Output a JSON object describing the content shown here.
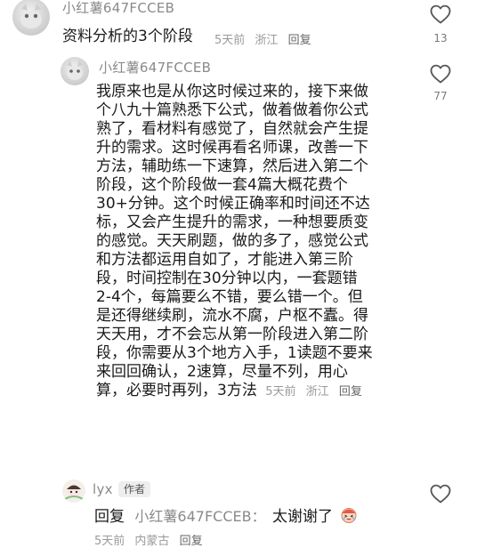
{
  "comment1": {
    "username": "小红薯647FCCEB",
    "text": "资料分析的3个阶段",
    "time": "5天前",
    "location": "浙江",
    "reply_label": "回复",
    "likes": "13"
  },
  "reply1": {
    "username": "小红薯647FCCEB",
    "lines": [
      "我原来也是从你这时候过来的，接下来做",
      "个八九十篇熟悉下公式，做着做着你公式",
      "熟了，看材料有感觉了，自然就会产生提",
      "升的需求。这时候再看名师课，改善一下",
      "方法，辅助练一下速算，然后进入第二个",
      "阶段，这个阶段做一套4篇大概花费个",
      "30+分钟。这个时候正确率和时间还不达",
      "标，又会产生提升的需求，一种想要质变",
      "的感觉。天天刷题，做的多了，感觉公式",
      "和方法都运用自如了，才能进入第三阶",
      "段，时间控制在30分钟以内，一套题错",
      "2-4个，每篇要么不错，要么错一个。但",
      "是还得继续刷，流水不腐，户枢不蠹。得",
      "天天用，才不会忘从第一阶段进入第二阶",
      "段，你需要从3个地方入手，1读题不要来",
      "来回回确认，2速算，尽量不列，用心"
    ],
    "last_line": "算，必要时再列，3方法",
    "time": "5天前",
    "location": "浙江",
    "reply_label": "回复",
    "likes": "77"
  },
  "reply2": {
    "username": "lyx",
    "author_tag": "作者",
    "prefix": "回复",
    "target": "小红薯647FCCEB：",
    "text": "太谢谢了",
    "emoji_name": "laughing-cry-emoji",
    "time": "5天前",
    "location": "内蒙古",
    "reply_label": "回复"
  },
  "icons": {
    "like": "heart-outline-icon"
  },
  "colors": {
    "text": "#1a1a1a",
    "meta": "#9a9a9a",
    "username": "#8a8a8a"
  }
}
